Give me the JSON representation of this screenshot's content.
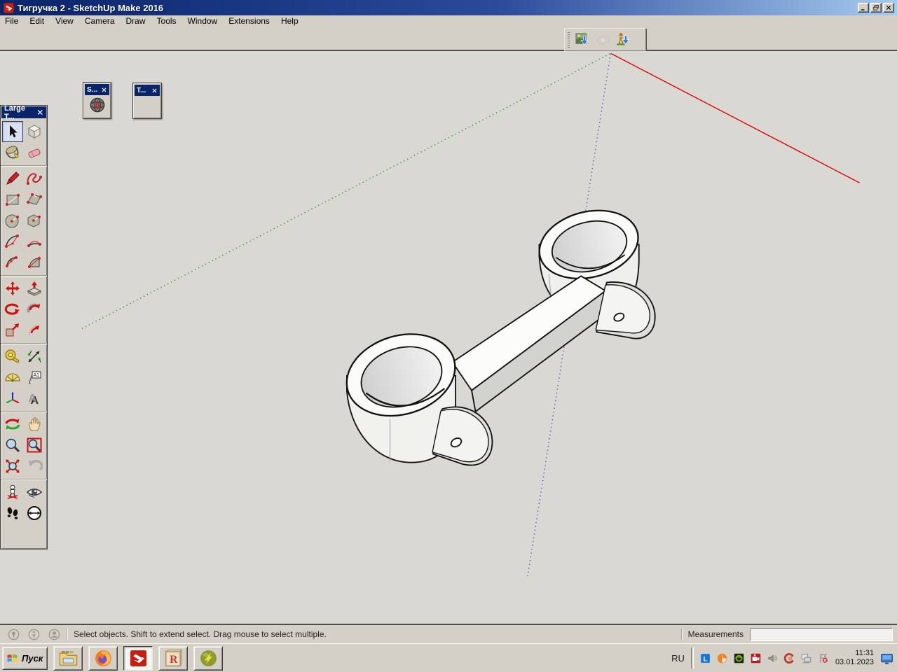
{
  "window": {
    "title": "Тигручка 2 - SketchUp Make 2016",
    "icon": "sketchup-logo",
    "controls": [
      "minimize",
      "restore",
      "close"
    ]
  },
  "menubar": {
    "items": [
      "File",
      "Edit",
      "View",
      "Camera",
      "Draw",
      "Tools",
      "Window",
      "Extensions",
      "Help"
    ]
  },
  "location_toolbar": {
    "tools": [
      {
        "id": "add-location",
        "enabled": true
      },
      {
        "id": "toggle-terrain",
        "enabled": false
      },
      {
        "id": "photo-textures",
        "enabled": true
      }
    ]
  },
  "tool_palette": {
    "title": "Large T...",
    "active_tool": "select",
    "groups": [
      {
        "tools": [
          "select",
          "make-component",
          "paint-bucket",
          "eraser"
        ]
      },
      {
        "tools": [
          "line",
          "freehand",
          "rectangle",
          "rotated-rectangle",
          "circle-tool",
          "polygon",
          "arc",
          "two-point-arc",
          "three-point-arc",
          "pie"
        ]
      },
      {
        "tools": [
          "move",
          "push-pull",
          "rotate",
          "follow-me",
          "scale",
          "offset"
        ]
      },
      {
        "tools": [
          "tape-measure",
          "dimension",
          "protractor",
          "text-tool",
          "axes-tool",
          "three-d-text"
        ]
      },
      {
        "tools": [
          "orbit",
          "pan",
          "zoom",
          "zoom-window",
          "zoom-extents",
          "previous"
        ]
      },
      {
        "tools": [
          "position-camera",
          "look-around",
          "walk",
          "section-plane"
        ]
      }
    ]
  },
  "mini_windows": [
    {
      "title": "S...",
      "icon": "globe-a"
    },
    {
      "title": "T...",
      "icon": ""
    }
  ],
  "axes": {
    "red": "#dd0000",
    "green": "#2e9b2e",
    "blue": "#5252cc"
  },
  "statusbar": {
    "icons": [
      "status-geolocation",
      "status-credits",
      "status-signin"
    ],
    "hint": "Select objects. Shift to extend select. Drag mouse to select multiple.",
    "measurements_label": "Measurements",
    "measurements_value": ""
  },
  "taskbar": {
    "start_label": "Пуск",
    "start_icon": "windows-flag",
    "apps": [
      {
        "id": "file-manager",
        "active": false
      },
      {
        "id": "firefox",
        "active": false
      },
      {
        "id": "sketchup",
        "active": true
      },
      {
        "id": "r-block",
        "active": false
      },
      {
        "id": "green-ball",
        "active": false
      }
    ],
    "tray": {
      "language": "RU",
      "icons": [
        "tray-l",
        "tray-avast",
        "tray-nvidia",
        "tray-recorder",
        "tray-volume",
        "tray-ccleaner",
        "tray-network",
        "tray-offline"
      ],
      "time": "11:31",
      "date": "03.01.2023",
      "show_desktop_icon": "show-desktop"
    }
  }
}
